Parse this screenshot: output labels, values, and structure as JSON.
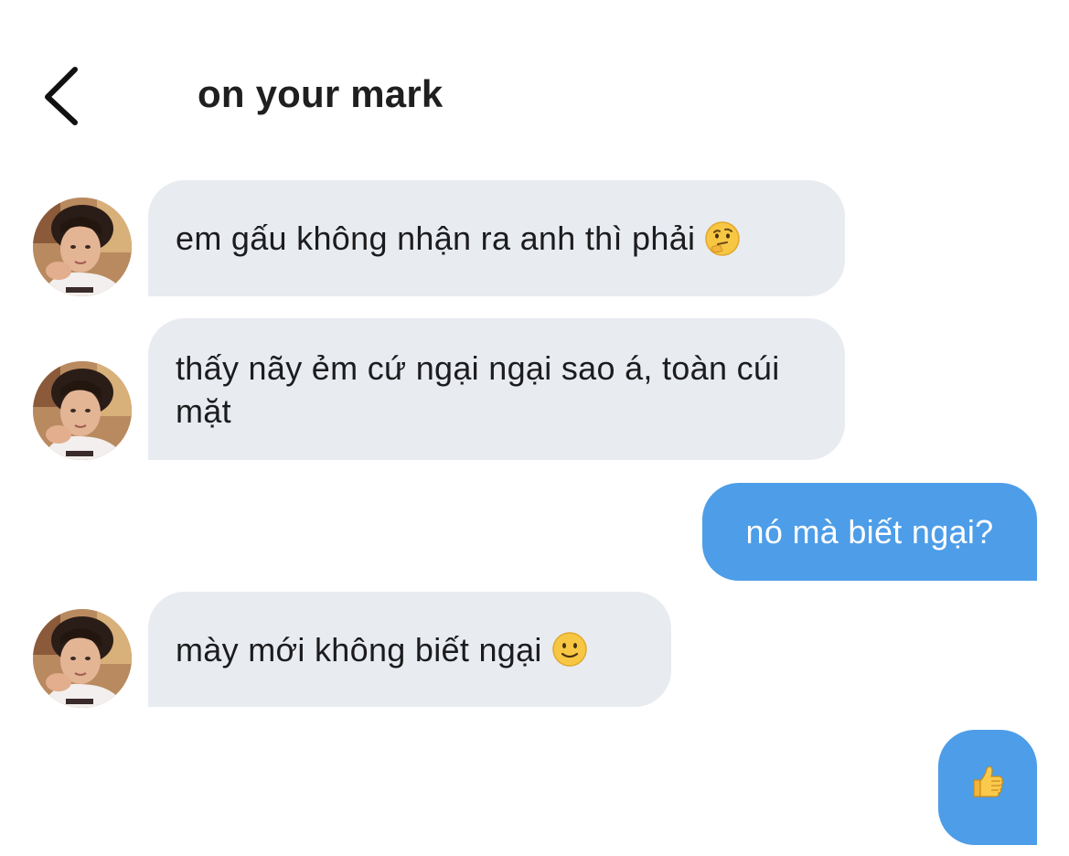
{
  "header": {
    "title": "on your mark",
    "back_icon": "chevron-left-icon"
  },
  "messages": [
    {
      "direction": "incoming",
      "text": "em gấu không nhận ra anh thì phải",
      "emoji": "thinking-face-icon"
    },
    {
      "direction": "incoming",
      "text": "thấy nãy ẻm cứ ngại ngại sao á, toàn cúi mặt"
    },
    {
      "direction": "outgoing",
      "text": "nó mà biết ngại?"
    },
    {
      "direction": "incoming",
      "text": "mày mới không biết ngại",
      "emoji": "slightly-smiling-face-icon"
    },
    {
      "direction": "outgoing",
      "emoji": "thumbs-up-icon"
    }
  ],
  "colors": {
    "incoming_bubble": "#e8ebf0",
    "outgoing_bubble": "#4d9de8",
    "outgoing_text": "#ffffff",
    "title": "#1f1f1f"
  }
}
